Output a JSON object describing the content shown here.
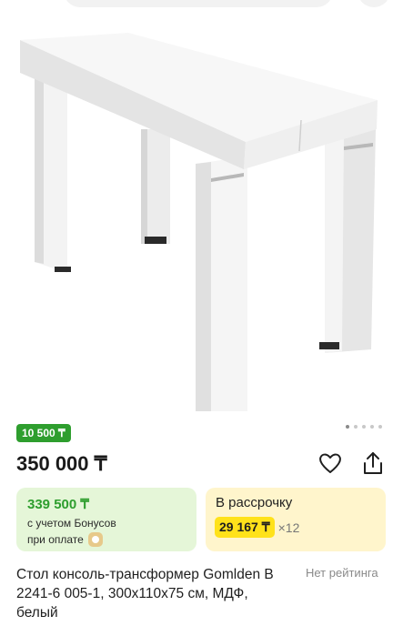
{
  "product": {
    "bonus_badge": "10 500 ₸",
    "price": "350 000 ₸",
    "title": "Стол консоль-трансформер Gomlden B 2241-6 005-1, 300x110x75 см, МДФ, белый",
    "rating_text": "Нет рейтинга",
    "image_icon": "white-console-table-photo",
    "gallery": {
      "total_dots": 5,
      "active_index": 0
    }
  },
  "bonus_card": {
    "price": "339 500 ₸",
    "line1": "с учетом Бонусов",
    "line2": "при оплате",
    "icon": "bonus-coin-icon"
  },
  "installment_card": {
    "title": "В рассрочку",
    "amount": "29 167 ₸",
    "multiplier": "×12"
  },
  "actions": {
    "favorite_icon": "heart-icon",
    "share_icon": "share-icon"
  },
  "colors": {
    "bonus_green": "#2e9e2e",
    "bonus_card_bg": "#e5f6d8",
    "install_card_bg": "#fff5cc",
    "install_highlight": "#ffe21a"
  }
}
